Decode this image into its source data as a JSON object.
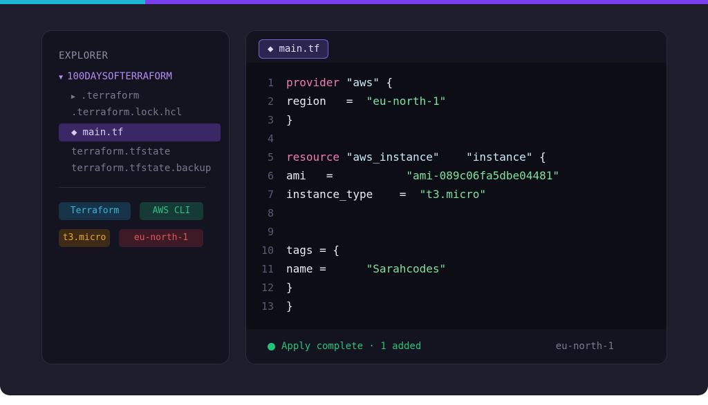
{
  "explorer": {
    "title": "EXPLORER",
    "folder": "100DAYSOFTERRAFORM",
    "items": [
      {
        "label": ".terraform",
        "collapsed": true
      },
      {
        "label": ".terraform.lock.hcl"
      },
      {
        "label": "main.tf",
        "active": true
      },
      {
        "label": "terraform.tfstate"
      },
      {
        "label": "terraform.tfstate.backup"
      }
    ],
    "badges": [
      "Terraform",
      "AWS CLI",
      "t3.micro",
      "eu-north-1"
    ]
  },
  "editor": {
    "tab_label": "main.tf",
    "lines": [
      {
        "n": "1"
      },
      {
        "n": "2"
      },
      {
        "n": "3"
      },
      {
        "n": "4"
      },
      {
        "n": "5"
      },
      {
        "n": "6"
      },
      {
        "n": "7"
      },
      {
        "n": "8"
      },
      {
        "n": "9"
      },
      {
        "n": "10"
      },
      {
        "n": "11"
      },
      {
        "n": "12"
      },
      {
        "n": "13"
      }
    ],
    "tokens": {
      "provider_kw": "provider",
      "provider_name": "\"aws\"",
      "open_brace": "{",
      "close_brace": "}",
      "region_key": "region",
      "region_val": "\"eu-north-1\"",
      "resource_kw": "resource",
      "resource_type": "\"aws_instance\"",
      "resource_name": "\"instance\"",
      "ami_key": "ami",
      "ami_val": "\"ami-089c06fa5dbe04481\"",
      "itype_key": "instance_type",
      "itype_val": "\"t3.micro\"",
      "tags_open": "tags = {",
      "name_key": "name =",
      "name_val": "\"Sarahcodes\"",
      "equals": "="
    }
  },
  "status": {
    "message": "Apply complete · 1 added",
    "region": "eu-north-1"
  },
  "colors": {
    "accent_cyan": "#1fb6d6",
    "accent_purple": "#7b3ff2",
    "keyword": "#f17bb5",
    "string": "#7fe0a0",
    "success": "#23c277"
  }
}
